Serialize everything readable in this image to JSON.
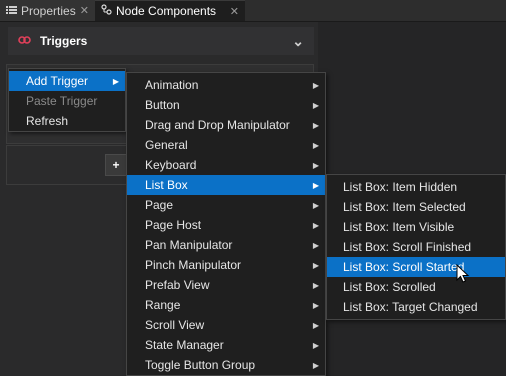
{
  "tabs": [
    {
      "label": "Properties",
      "icon": "list-icon",
      "active": false
    },
    {
      "label": "Node Components",
      "icon": "nodes-icon",
      "active": true
    }
  ],
  "section": {
    "title": "Triggers",
    "icon": "triggers-icon"
  },
  "add_button_label": "+",
  "context_menu": [
    {
      "label": "Add Trigger",
      "highlighted": true,
      "has_submenu": true
    },
    {
      "label": "Paste Trigger",
      "disabled": true
    },
    {
      "label": "Refresh"
    }
  ],
  "trigger_categories": [
    {
      "label": "Animation"
    },
    {
      "label": "Button"
    },
    {
      "label": "Drag and Drop Manipulator"
    },
    {
      "label": "General"
    },
    {
      "label": "Keyboard"
    },
    {
      "label": "List Box",
      "highlighted": true
    },
    {
      "label": "Page"
    },
    {
      "label": "Page Host"
    },
    {
      "label": "Pan Manipulator"
    },
    {
      "label": "Pinch Manipulator"
    },
    {
      "label": "Prefab View"
    },
    {
      "label": "Range"
    },
    {
      "label": "Scroll View"
    },
    {
      "label": "State Manager"
    },
    {
      "label": "Toggle Button Group"
    }
  ],
  "list_box_triggers": [
    {
      "label": "List Box: Item Hidden"
    },
    {
      "label": "List Box: Item Selected"
    },
    {
      "label": "List Box: Item Visible"
    },
    {
      "label": "List Box: Scroll Finished"
    },
    {
      "label": "List Box: Scroll Started",
      "highlighted": true
    },
    {
      "label": "List Box: Scrolled"
    },
    {
      "label": "List Box: Target Changed"
    }
  ],
  "colors": {
    "highlight": "#0b71c7",
    "menu_bg": "#1f1f1f",
    "panel_bg": "#2a2a2b"
  }
}
